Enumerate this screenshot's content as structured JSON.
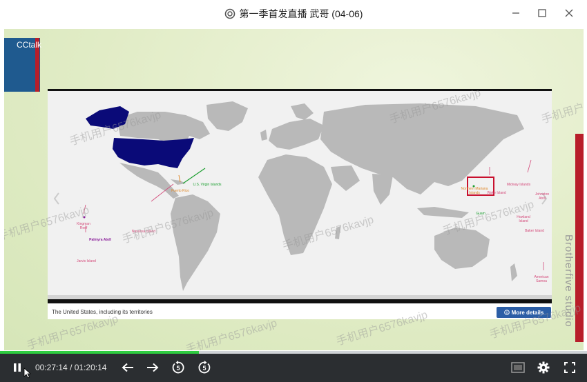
{
  "window": {
    "title": "第一季首发直播 武哥 (04-06)"
  },
  "overlay": {
    "cctalk_label": "CCtalk",
    "vertical_text": "Brotherfive studio"
  },
  "slide": {
    "caption": "The United States, including its territories",
    "more_details_label": "More details",
    "labels": {
      "us_virgin_islands": "U.S. Virgin Islands",
      "puerto_rico": "Puerto Rico",
      "navassa_island": "Navassa Island",
      "kingman_reef": "Kingman Reef",
      "palmyra_atoll": "Palmyra Atoll",
      "jarvis_island": "Jarvis Island",
      "northern_mariana_islands": "Northern Mariana Islands",
      "wake_island": "Wake Island",
      "midway_islands": "Midway Islands",
      "johnston_atoll": "Johnston Atoll",
      "guam": "Guam",
      "howland_island": "Howland Island",
      "baker_island": "Baker Island",
      "american_samoa": "American Samoa"
    }
  },
  "watermark": "手机用户6576kavjp",
  "player": {
    "current_time": "00:27:14",
    "separator": "/",
    "total_time": "01:20:14",
    "progress_fraction": 0.339
  },
  "colors": {
    "us_fill": "#0a0a78",
    "land": "#b9b9b9",
    "progress": "#2ecc40",
    "accent_red": "#b81e2a"
  }
}
